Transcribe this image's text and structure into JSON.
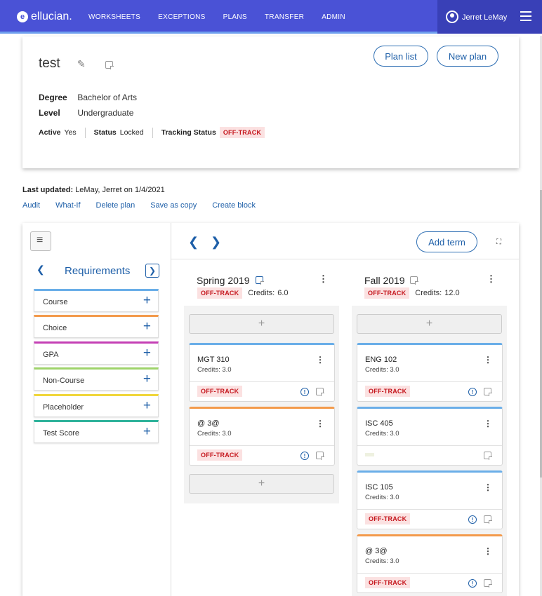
{
  "nav": {
    "brand": "ellucian.",
    "links": [
      "WORKSHEETS",
      "EXCEPTIONS",
      "PLANS",
      "TRANSFER",
      "ADMIN"
    ],
    "user": "Jerret LeMay"
  },
  "plan": {
    "title": "test",
    "buttons": {
      "plan_list": "Plan list",
      "new_plan": "New plan"
    },
    "degree_label": "Degree",
    "degree_value": "Bachelor of Arts",
    "level_label": "Level",
    "level_value": "Undergraduate",
    "active_label": "Active",
    "active_value": "Yes",
    "status_label": "Status",
    "status_value": "Locked",
    "tracking_label": "Tracking Status",
    "tracking_value": "OFF-TRACK"
  },
  "last_updated": {
    "label": "Last updated:",
    "value": "LeMay, Jerret on 1/4/2021"
  },
  "actions": [
    "Audit",
    "What-If",
    "Delete plan",
    "Save as copy",
    "Create block"
  ],
  "requirements": {
    "title": "Requirements",
    "items": [
      {
        "label": "Course",
        "color": "#6aaee8"
      },
      {
        "label": "Choice",
        "color": "#f39a4b"
      },
      {
        "label": "GPA",
        "color": "#c43fb5"
      },
      {
        "label": "Non-Course",
        "color": "#9ed36a"
      },
      {
        "label": "Placeholder",
        "color": "#f0d63a"
      },
      {
        "label": "Test Score",
        "color": "#2fb39b"
      }
    ]
  },
  "board": {
    "add_term": "Add term",
    "credits_label": "Credits:",
    "terms": [
      {
        "name": "Spring 2019",
        "status": "OFF-TRACK",
        "credits": "6.0",
        "courses": [
          {
            "name": "MGT 310",
            "credits": "Credits: 3.0",
            "status": "OFF-TRACK",
            "color": "#6aaee8"
          },
          {
            "name": "@ 3@",
            "credits": "Credits: 3.0",
            "status": "OFF-TRACK",
            "color": "#f39a4b"
          }
        ]
      },
      {
        "name": "Fall 2019",
        "status": "OFF-TRACK",
        "credits": "12.0",
        "courses": [
          {
            "name": "ENG 102",
            "credits": "Credits: 3.0",
            "status": "OFF-TRACK",
            "color": "#6aaee8"
          },
          {
            "name": "ISC 405",
            "credits": "Credits: 3.0",
            "status": "",
            "color": "#6aaee8"
          },
          {
            "name": "ISC 105",
            "credits": "Credits: 3.0",
            "status": "OFF-TRACK",
            "color": "#6aaee8"
          },
          {
            "name": "@ 3@",
            "credits": "Credits: 3.0",
            "status": "OFF-TRACK",
            "color": "#f39a4b"
          }
        ]
      }
    ]
  }
}
